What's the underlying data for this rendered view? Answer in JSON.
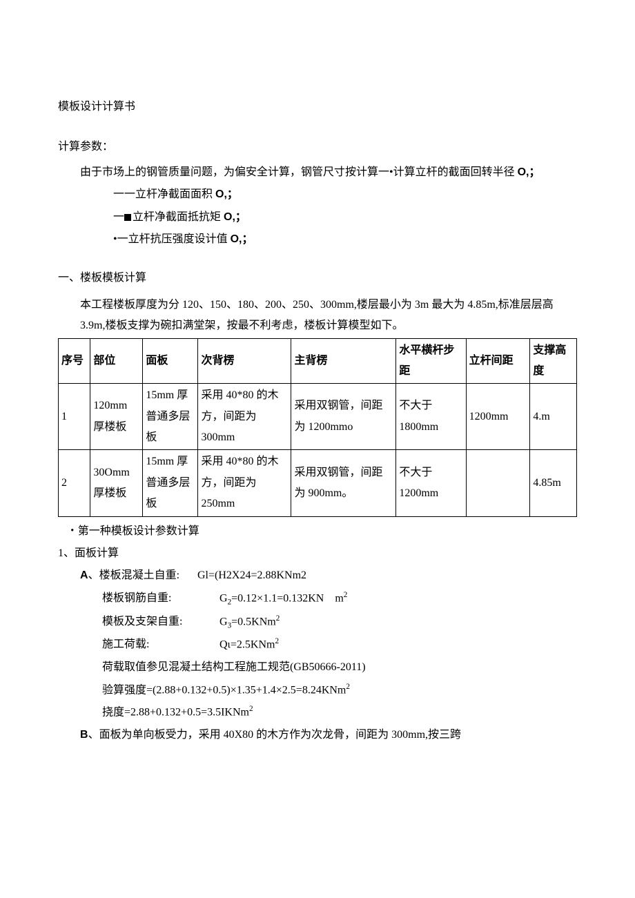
{
  "title": "模板设计计算书",
  "params_heading": "计算参数：",
  "params_intro": "由于市场上的钢管质量问题，为偏安全计算，钢管尺寸按计算一•计算立杆的截面回转半径 ",
  "params_intro_bold": "O,；",
  "param_lines": [
    {
      "prefix": "一一立杆净截面面积 ",
      "bold": "O,；"
    },
    {
      "prefix_marker": true,
      "prefix": "一",
      "mid": "立杆净截面抵抗矩 ",
      "bold": "O,；"
    },
    {
      "prefix": "•一立杆抗压强度设计值 ",
      "bold": "O,；"
    }
  ],
  "section1_heading": "一、楼板模板计算",
  "section1_intro": "本工程楼板厚度为分 120、150、180、200、250、300mm,楼层最小为 3m 最大为 4.85m,标准层层高 3.9m,楼板支撑为碗扣满堂架，按最不利考虑，楼板计算模型如下。",
  "table": {
    "headers": [
      "序号",
      "部位",
      "面板",
      "次背楞",
      "主背楞",
      "水平横杆步距",
      "立杆间距",
      "支撑高度"
    ],
    "rows": [
      [
        "1",
        "120mm 厚楼板",
        "15mm 厚普通多层板",
        "采用 40*80 的木方，间距为 300mm",
        "采用双钢管，间距为 1200mmo",
        "不大于 1800mm",
        "1200mm",
        "4.m"
      ],
      [
        "2",
        "30Omm 厚楼板",
        "15mm 厚普通多层板",
        "采用 40*80 的木方，间距为 250mm",
        "采用双钢管，间距为 900mm。",
        "不大于 1200mm",
        "",
        "4.85m"
      ]
    ]
  },
  "note_after_table": "・第一种模板设计参数计算",
  "calc_panel_heading": "1、面板计算",
  "calc_A_prefix_bold": "A",
  "calc_A_prefix": "、楼板混凝土自重:",
  "calc_A_val_html": "Gl=(H2X24=2.88KNm2",
  "calc_rows": [
    {
      "label": "楼板钢筋自重:",
      "value_html": "G<sub>2</sub>=0.12×1.1=0.132KN&nbsp;&nbsp;&nbsp;&nbsp;m<sup>2</sup>"
    },
    {
      "label": "模板及支架自重:",
      "value_html": "G<sub>3</sub>=0.5KNm<sup>2</sup>"
    },
    {
      "label": "施工荷载:",
      "value_html": "Qι=2.5KNm<sup>2</sup>"
    }
  ],
  "load_ref": "荷载取值参见混凝土结构工程施工规范(GB50666-2011)",
  "strength": "验算强度=(2.88+0.132+0.5)×1.35+1.4×2.5=8.24KNm",
  "deflection": "挠度=2.88+0.132+0.5=3.5IKNm",
  "calc_B_prefix_bold": "B",
  "calc_B_text": "、面板为单向板受力，采用 40X80 的木方作为次龙骨，间距为 300mm,按三跨"
}
